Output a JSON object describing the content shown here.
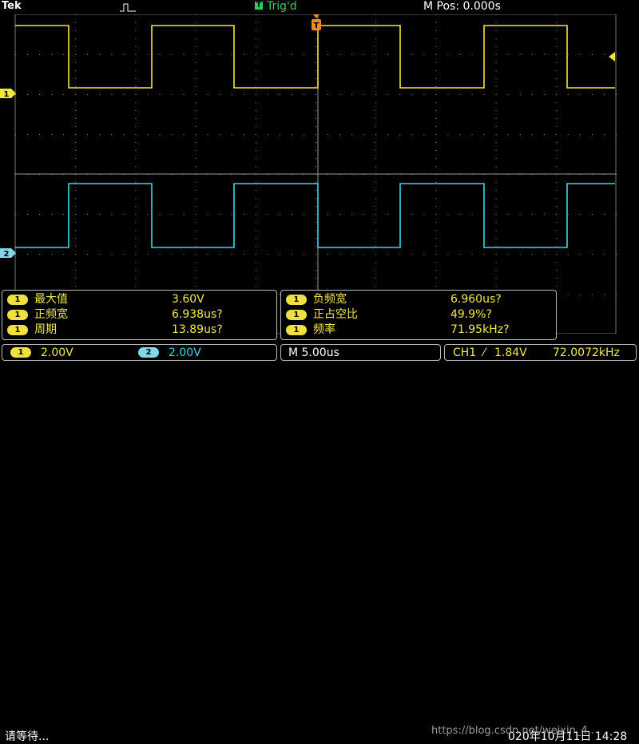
{
  "topbar": {
    "brand": "Tek",
    "pulse_icon": "pulse-icon",
    "trig_icon_label": "T",
    "trigger_status": "Trig'd",
    "m_pos": "M Pos: 0.000s"
  },
  "channels": {
    "ch1_marker": "1",
    "ch2_marker": "2",
    "ch1_color": "#f5e63a",
    "ch2_color": "#3ad6e6"
  },
  "measurements": {
    "left": [
      {
        "badge": "1",
        "label": "最大值",
        "value": "3.60V"
      },
      {
        "badge": "1",
        "label": "正频宽",
        "value": "6.938us?"
      },
      {
        "badge": "1",
        "label": "周期",
        "value": "13.89us?"
      }
    ],
    "right": [
      {
        "badge": "1",
        "label": "负频宽",
        "value": "6.960us?"
      },
      {
        "badge": "1",
        "label": "正占空比",
        "value": "49.9%?"
      },
      {
        "badge": "1",
        "label": "频率",
        "value": "71.95kHz?"
      }
    ]
  },
  "statusbar": {
    "ch1_badge": "1",
    "ch1_scale": "2.00V",
    "ch2_badge": "2",
    "ch2_scale": "2.00V",
    "timebase": "M 5.00us",
    "trigger_source": "CH1",
    "trigger_slope": "⁄",
    "trigger_level": "1.84V",
    "frequency": "72.0072kHz"
  },
  "footer": {
    "status": "请等待...",
    "date": "020年10月11日 14:28",
    "watermark": "https://blog.csdn.net/weixin_4.."
  }
}
